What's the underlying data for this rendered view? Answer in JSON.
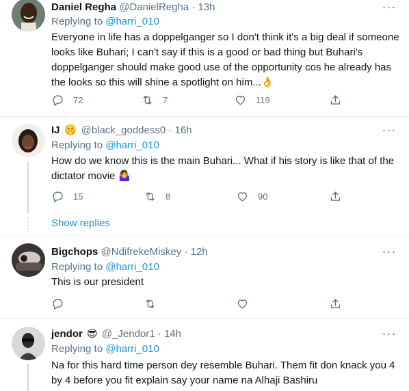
{
  "tweets": [
    {
      "name": "Daniel Regha",
      "handle": "@DanielRegha",
      "separator": "·",
      "time": "13h",
      "reply_prefix": "Replying to ",
      "reply_mention": "@harri_010",
      "text": "Everyone in life has a doppelganger so I don't think it's a big deal if someone looks like Buhari; I can't say if this is a good or bad thing but Buhari's doppelganger should make good use of the opportunity cos he already has the looks so this will shine a spotlight on him...👌",
      "replies": "72",
      "retweets": "7",
      "likes": "119"
    },
    {
      "name": "IJ",
      "name_emoji": "🤫",
      "handle": "@black_goddess0",
      "separator": "·",
      "time": "16h",
      "reply_prefix": "Replying to ",
      "reply_mention": "@harri_010",
      "text": "How do we know this is the main Buhari... What if his story is like that of the dictator movie 🤷‍♀️",
      "replies": "15",
      "retweets": "8",
      "likes": "90"
    },
    {
      "name": "Bigchops",
      "handle": "@NdifrekeMiskey",
      "separator": "·",
      "time": "12h",
      "reply_prefix": "Replying to ",
      "reply_mention": "@harri_010",
      "text": "This is our president",
      "replies": "",
      "retweets": "",
      "likes": ""
    },
    {
      "name": "jendor",
      "name_emoji": "😎",
      "handle": "@_Jendor1",
      "separator": "·",
      "time": "14h",
      "reply_prefix": "Replying to ",
      "reply_mention": "@harri_010",
      "text": "Na for this hard time person dey resemble Buhari. Them fit don knack you 4 by 4 before you fit explain  say your name na Alhaji Bashiru"
    }
  ],
  "show_replies_label": "Show replies",
  "more_glyph": "···",
  "icons": {
    "reply": "reply-icon",
    "retweet": "retweet-icon",
    "like": "heart-icon",
    "share": "share-icon",
    "more": "more-icon"
  },
  "colors": {
    "link": "#1b95e0",
    "secondary_text": "#5b7083",
    "divider": "#e6ecf0"
  }
}
